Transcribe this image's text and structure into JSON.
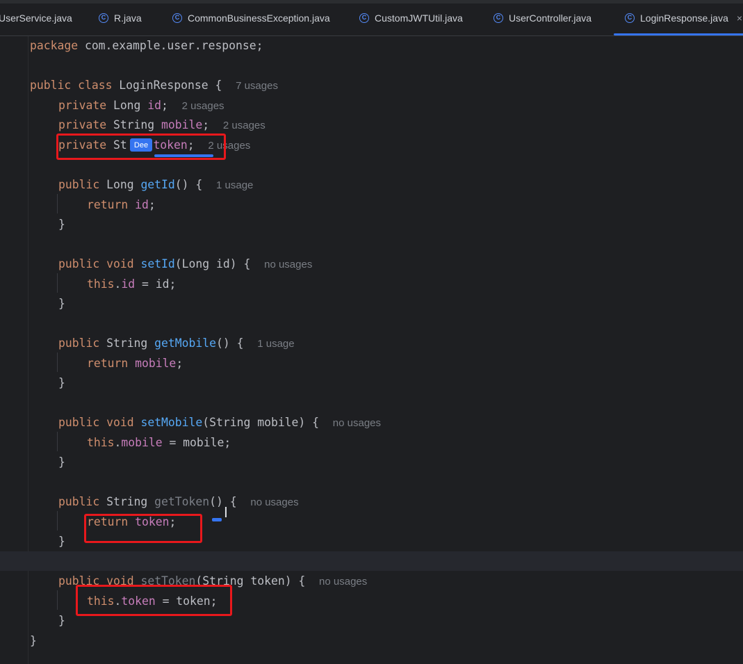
{
  "tabs": [
    {
      "label": "UserService.java",
      "active": false
    },
    {
      "label": "R.java",
      "active": false
    },
    {
      "label": "CommonBusinessException.java",
      "active": false
    },
    {
      "label": "CustomJWTUtil.java",
      "active": false
    },
    {
      "label": "UserController.java",
      "active": false
    },
    {
      "label": "LoginResponse.java",
      "active": true
    }
  ],
  "tab_icon_letter": "C",
  "close_glyph": "×",
  "badge_text": "Dee",
  "code": {
    "package_line": {
      "kw": "package",
      "text": " com.example.user.response;"
    },
    "class_decl": {
      "kw1": "public",
      "kw2": "class",
      "name": " LoginResponse {",
      "hint": "7 usages"
    },
    "field_id": {
      "kw": "private",
      "type": " Long ",
      "name": "id",
      "tail": ";",
      "hint": "2 usages"
    },
    "field_mobile": {
      "kw": "private",
      "type": " String ",
      "name": "mobile",
      "tail": ";",
      "hint": "2 usages"
    },
    "field_token": {
      "kw": "private",
      "type": " St",
      "type2": "g ",
      "name": "token",
      "tail": ";",
      "hint": "2 usages"
    },
    "getId": {
      "kw": "public",
      "sig1": " Long ",
      "fname": "getId",
      "sig2": "() {",
      "hint": "1 usage",
      "body_kw": "return",
      "body_field": "id",
      "body_tail": ";"
    },
    "setId": {
      "kw1": "public",
      "kw2": "void",
      "fname": "setId",
      "sig2": "(Long id) {",
      "hint": "no usages",
      "body_kw": "this",
      "body_field": "id",
      "body_tail": " = id;"
    },
    "getMobile": {
      "kw": "public",
      "sig1": " String ",
      "fname": "getMobile",
      "sig2": "() {",
      "hint": "1 usage",
      "body_kw": "return",
      "body_field": "mobile",
      "body_tail": ";"
    },
    "setMobile": {
      "kw1": "public",
      "kw2": "void",
      "fname": "setMobile",
      "sig2": "(String mobile) {",
      "hint": "no usages",
      "body_kw": "this",
      "body_field": "mobile",
      "body_tail": " = mobile;"
    },
    "getToken": {
      "kw": "public",
      "sig1": " String ",
      "fname": "getToken",
      "sig2": "() {",
      "hint": "no usages",
      "body_kw": "return",
      "body_field": "token",
      "body_tail": ";"
    },
    "setToken": {
      "kw1": "public",
      "kw2": "void",
      "fname": "setToken",
      "sig2": "(String token) {",
      "hint": "no usages",
      "body_kw": "this",
      "body_field": "token",
      "body_tail": " = token;"
    },
    "close_brace": "}"
  },
  "colors": {
    "keyword": "#cf8e6d",
    "field": "#c77dbb",
    "method": "#56a8f5",
    "text": "#bcbec4",
    "hint": "#7a7e85",
    "highlight_box": "#e8181c",
    "accent": "#3574f0"
  }
}
